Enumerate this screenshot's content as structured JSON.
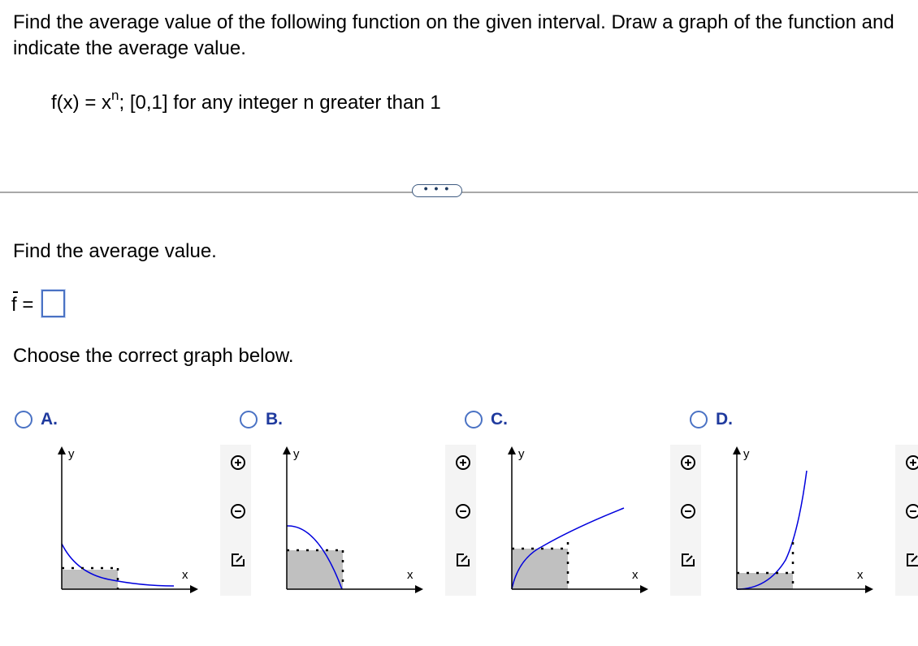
{
  "question": {
    "text": "Find the average value of the following function on the given interval. Draw a graph of the function and indicate the average value.",
    "function_prefix": "f(x) = x",
    "function_exponent": "n",
    "function_suffix": "; [0,1] for any integer n greater than 1"
  },
  "more_button": {
    "label": "• • •"
  },
  "part1": {
    "prompt": "Find the average value.",
    "answer_label": "f =",
    "answer_value": ""
  },
  "part2": {
    "prompt": "Choose the correct graph below.",
    "options": [
      {
        "letter": "A.",
        "y_label": "y",
        "x_label": "x"
      },
      {
        "letter": "B.",
        "y_label": "y",
        "x_label": "x"
      },
      {
        "letter": "C.",
        "y_label": "y",
        "x_label": "x"
      },
      {
        "letter": "D.",
        "y_label": "y",
        "x_label": "x"
      }
    ]
  },
  "colors": {
    "curve": "#0000dd",
    "shade": "#c0c0c0",
    "accent": "#4a72c4"
  },
  "icons": [
    "zoom-in-icon",
    "zoom-out-icon",
    "expand-icon"
  ]
}
